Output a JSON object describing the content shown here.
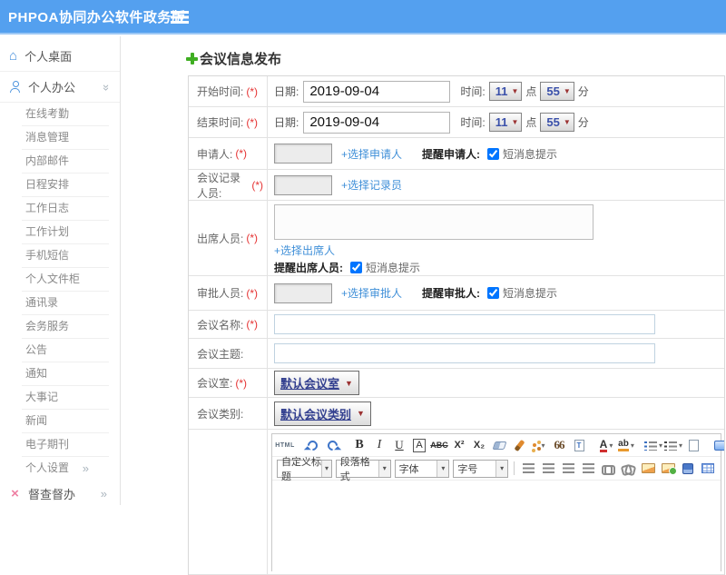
{
  "colors": {
    "header_bg": "#54a0ef",
    "link_blue": "#3f8fd8",
    "required_red": "#e53333",
    "plus_green": "#3fae22"
  },
  "header": {
    "title": "PHPOA协同办公软件政务版",
    "menu_icon": "hamburger-icon"
  },
  "sidebar": {
    "desktop": {
      "label": "个人桌面",
      "icon": "home-icon"
    },
    "office": {
      "label": "个人办公",
      "icon": "user-icon",
      "chevron": "double-chevron-down"
    },
    "sub_items": [
      "在线考勤",
      "消息管理",
      "内部邮件",
      "日程安排",
      "工作日志",
      "工作计划",
      "手机短信",
      "个人文件柜",
      "通讯录",
      "会务服务",
      "公告",
      "通知",
      "大事记",
      "新闻",
      "电子期刊"
    ],
    "settings": {
      "label": "个人设置",
      "chevron": "chevron-right"
    },
    "supervise": {
      "label": "督查督办",
      "icon": "supervise-icon",
      "chevron": "chevron-right"
    }
  },
  "main": {
    "page_title": "会议信息发布",
    "form": {
      "start": {
        "label": "开始时间:",
        "req": "(*)",
        "date_label": "日期:",
        "date_value": "2019-09-04",
        "time_label": "时间:",
        "hour": "11",
        "hour_unit": "点",
        "minute": "55",
        "minute_unit": "分"
      },
      "end": {
        "label": "结束时间:",
        "req": "(*)",
        "date_label": "日期:",
        "date_value": "2019-09-04",
        "time_label": "时间:",
        "hour": "11",
        "hour_unit": "点",
        "minute": "55",
        "minute_unit": "分"
      },
      "applicant": {
        "label": "申请人:",
        "req": "(*)",
        "link": "+选择申请人",
        "remind": "提醒申请人:",
        "sms": "短消息提示"
      },
      "recorder": {
        "label": "会议记录人员:",
        "req": "(*)",
        "link": "+选择记录员"
      },
      "attendees": {
        "label": "出席人员:",
        "req": "(*)",
        "link": "+选择出席人",
        "remind": "提醒出席人员:",
        "sms": "短消息提示"
      },
      "approver": {
        "label": "审批人员:",
        "req": "(*)",
        "link": "+选择审批人",
        "remind": "提醒审批人:",
        "sms": "短消息提示"
      },
      "name": {
        "label": "会议名称:",
        "req": "(*)",
        "value": ""
      },
      "subject": {
        "label": "会议主题:",
        "value": ""
      },
      "room": {
        "label": "会议室:",
        "req": "(*)",
        "value": "默认会议室"
      },
      "category": {
        "label": "会议类别:",
        "value": "默认会议类别"
      }
    },
    "editor": {
      "toolbar_row1": [
        {
          "name": "html-source-button",
          "kind": "text",
          "glyph": "HTML"
        },
        {
          "name": "toolbar-divider",
          "kind": "sep"
        },
        {
          "name": "undo-icon",
          "kind": "undo"
        },
        {
          "name": "redo-icon",
          "kind": "redo"
        },
        {
          "name": "toolbar-divider",
          "kind": "sep"
        },
        {
          "name": "bold-icon",
          "kind": "text-b",
          "glyph": "B"
        },
        {
          "name": "italic-icon",
          "kind": "text-i",
          "glyph": "I"
        },
        {
          "name": "underline-icon",
          "kind": "text-u",
          "glyph": "U"
        },
        {
          "name": "font-box-icon",
          "kind": "text-boxed",
          "glyph": "A"
        },
        {
          "name": "strikethrough-icon",
          "kind": "text-strike",
          "glyph": "ABC"
        },
        {
          "name": "superscript-icon",
          "kind": "text-sup",
          "glyph": "X²"
        },
        {
          "name": "subscript-icon",
          "kind": "text-sub",
          "glyph": "X₂"
        },
        {
          "name": "remove-format-eraser-icon",
          "kind": "eraser"
        },
        {
          "name": "paintbrush-icon",
          "kind": "brush"
        },
        {
          "name": "format-painter-icon",
          "kind": "spray",
          "caret": true
        },
        {
          "name": "blockquote-icon",
          "kind": "quote",
          "glyph": "66"
        },
        {
          "name": "paste-plain-text-icon",
          "kind": "page-t",
          "glyph": "T"
        },
        {
          "name": "toolbar-divider",
          "kind": "sep"
        },
        {
          "name": "font-color-icon",
          "kind": "color-a",
          "glyph": "A",
          "caret": true
        },
        {
          "name": "highlight-color-icon",
          "kind": "highlight",
          "glyph": "ab",
          "caret": true
        },
        {
          "name": "toolbar-divider",
          "kind": "sep"
        },
        {
          "name": "ordered-list-icon",
          "kind": "list-ol",
          "caret": true
        },
        {
          "name": "unordered-list-icon",
          "kind": "list-ul",
          "caret": true
        },
        {
          "name": "new-document-icon",
          "kind": "page"
        },
        {
          "name": "toolbar-divider",
          "kind": "sep"
        },
        {
          "name": "fullscreen-icon",
          "kind": "monitor"
        }
      ],
      "toolbar_row2_selects": [
        {
          "name": "heading-select",
          "label": "自定义标题"
        },
        {
          "name": "paragraph-format-select",
          "label": "段落格式"
        },
        {
          "name": "font-family-select",
          "label": "字体"
        },
        {
          "name": "font-size-select",
          "label": "字号"
        }
      ],
      "toolbar_row2_icons": [
        {
          "name": "align-left-icon",
          "kind": "bars"
        },
        {
          "name": "align-center-icon",
          "kind": "bars"
        },
        {
          "name": "align-right-icon",
          "kind": "bars"
        },
        {
          "name": "align-justify-icon",
          "kind": "bars"
        },
        {
          "name": "link-icon",
          "kind": "link"
        },
        {
          "name": "unlink-icon",
          "kind": "unlink"
        },
        {
          "name": "image-icon",
          "kind": "img"
        },
        {
          "name": "image-upload-icon",
          "kind": "img-plus"
        },
        {
          "name": "media-icon",
          "kind": "media"
        },
        {
          "name": "table-icon",
          "kind": "table"
        }
      ]
    }
  }
}
